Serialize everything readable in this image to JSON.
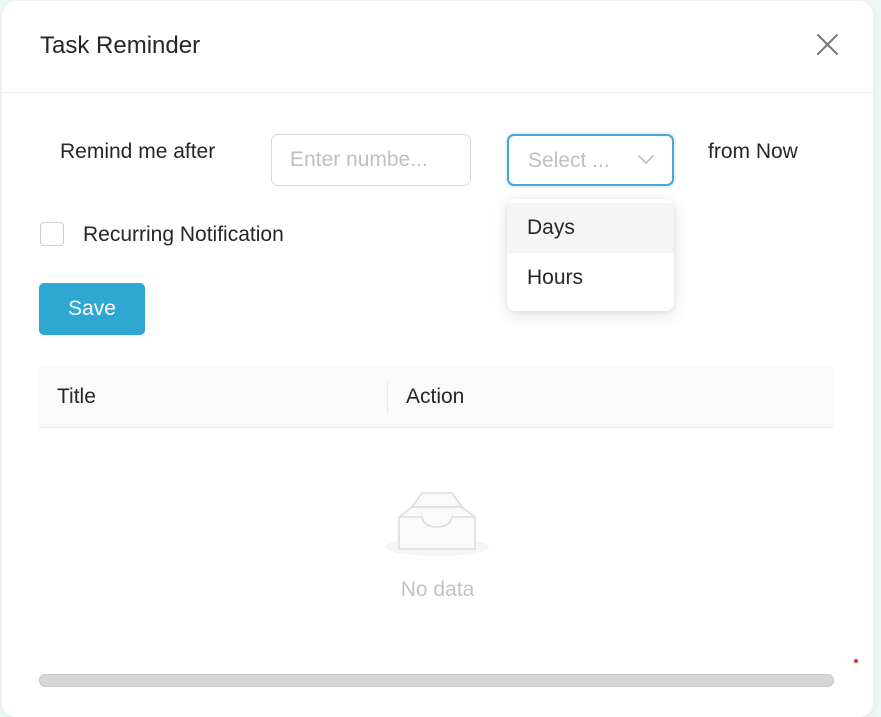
{
  "modal": {
    "title": "Task Reminder"
  },
  "form": {
    "remind_label": "Remind me after",
    "number_input": {
      "value": "",
      "placeholder": "Enter numbe..."
    },
    "unit_select": {
      "placeholder": "Select ...",
      "options": [
        "Days",
        "Hours"
      ],
      "highlighted": "Days"
    },
    "from_label": "from Now",
    "recurring": {
      "label": "Recurring Notification",
      "checked": false
    },
    "save_label": "Save"
  },
  "table": {
    "columns": [
      "Title",
      "Action"
    ],
    "rows": [],
    "empty_text": "No data"
  },
  "icons": {
    "close": "close-icon",
    "arrow": "chevron-down-icon",
    "empty": "empty-inbox-icon"
  },
  "colors": {
    "primary": "#2ea7d3",
    "focus_border": "#4ca3d6",
    "muted_text": "#bfbfbf"
  }
}
